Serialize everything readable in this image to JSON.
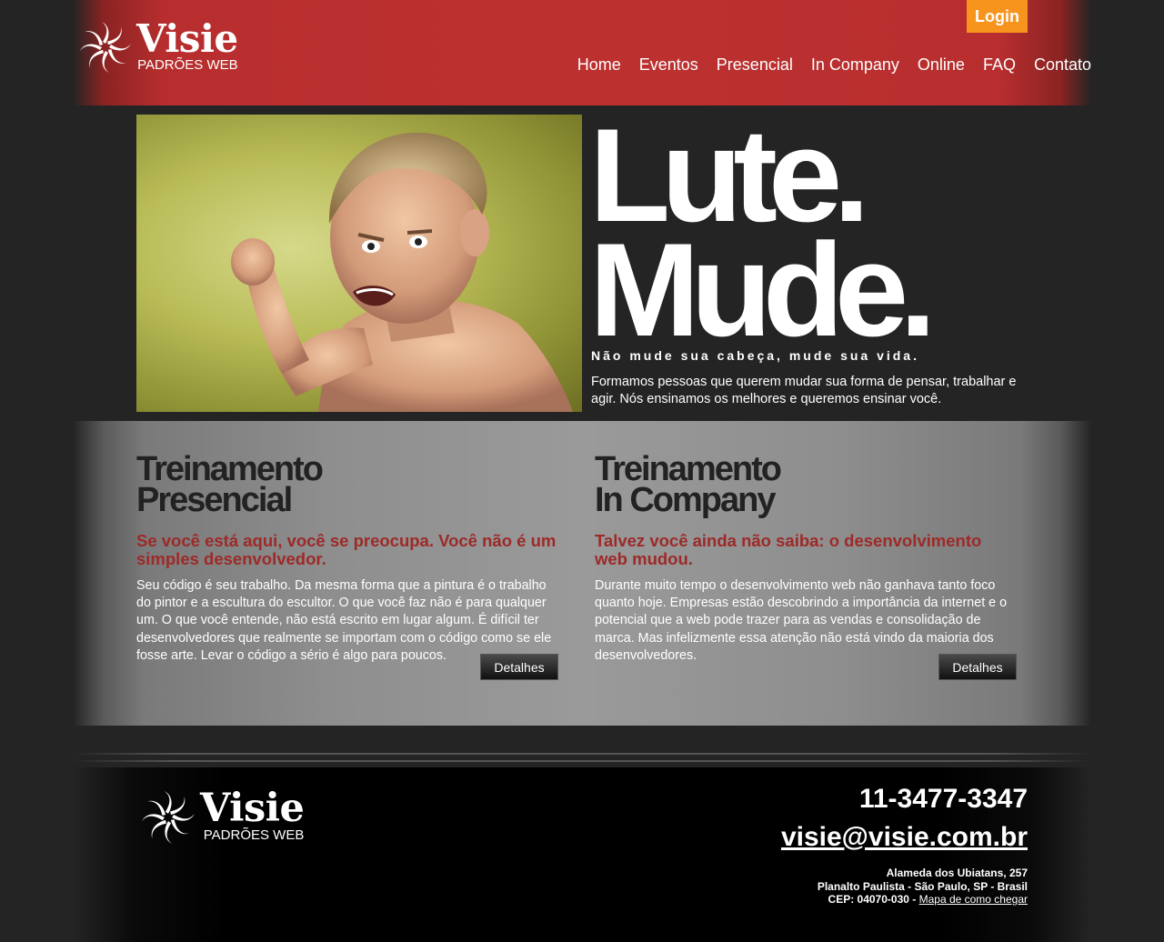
{
  "header": {
    "logo_brand": "Visie",
    "logo_sub": "PADRÕES WEB",
    "login_label": "Login",
    "nav": [
      "Home",
      "Eventos",
      "Presencial",
      "In Company",
      "Online",
      "FAQ",
      "Contato"
    ]
  },
  "hero": {
    "title_line1": "Lute.",
    "title_line2": "Mude.",
    "tagline": "Não mude sua cabeça, mude sua vida.",
    "description": "Formamos pessoas que querem mudar sua forma de pensar, trabalhar e agir. Nós ensinamos os melhores e queremos ensinar você.",
    "image_subject": "angry boy flexing arm against yellow-green wall"
  },
  "trainings": [
    {
      "title_line1": "Treinamento",
      "title_line2": "Presencial",
      "subtitle": "Se você está aqui, você se preocupa. Você não é um simples desenvolvedor.",
      "body": "Seu código é seu trabalho. Da mesma forma que a pintura é o trabalho do pintor e a escultura do escultor. O que você faz não é para qualquer um. O que você entende, não está escrito em lugar algum. É difícil ter desenvolvedores que realmente se importam com o código como se ele fosse arte. Levar o código a sério é algo para poucos.",
      "button": "Detalhes"
    },
    {
      "title_line1": "Treinamento",
      "title_line2": "In Company",
      "subtitle": "Talvez você ainda não saiba: o desenvolvimento web mudou.",
      "body": "Durante muito tempo o desenvolvimento web não ganhava tanto foco quanto hoje. Empresas estão descobrindo a importância da internet e o potencial que a web pode trazer para as vendas e consolidação de marca. Mas infelizmente essa atenção não está vindo da maioria dos desenvolvedores.",
      "button": "Detalhes"
    }
  ],
  "footer": {
    "logo_brand": "Visie",
    "logo_sub": "PADRÕES WEB",
    "phone": "11-3477-3347",
    "email": "visie@visie.com.br",
    "address_line1": "Alameda dos Ubiatans, 257",
    "address_line2": "Planalto Paulista - São Paulo, SP - Brasil",
    "address_line3": "CEP: 04070-030 - ",
    "map_link": "Mapa de como chegar"
  },
  "colors": {
    "header_red": "#bd3030",
    "accent_orange": "#f7941d",
    "subtitle_red": "#9c2a28"
  }
}
